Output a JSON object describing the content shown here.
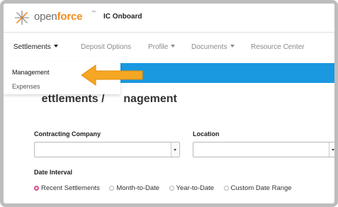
{
  "header": {
    "logo_open": "open",
    "logo_force": "force",
    "logo_tm": "™",
    "app_title": "IC Onboard"
  },
  "nav": {
    "items": [
      {
        "label": "Settlements",
        "has_caret": true,
        "active": true
      },
      {
        "label": "Deposit Options",
        "has_caret": false,
        "active": false
      },
      {
        "label": "Profile",
        "has_caret": true,
        "active": false
      },
      {
        "label": "Documents",
        "has_caret": true,
        "active": false
      },
      {
        "label": "Resource Center",
        "has_caret": false,
        "active": false
      }
    ],
    "dropdown": [
      {
        "label": "Management",
        "selected": true
      },
      {
        "label": "Expenses",
        "selected": false
      }
    ]
  },
  "page": {
    "title_visible": "ettlements / ",
    "title_end": "nagement"
  },
  "form": {
    "contracting_company_label": "Contracting Company",
    "contracting_company_value": "",
    "location_label": "Location",
    "location_value": "",
    "date_interval_label": "Date Interval",
    "date_interval_options": [
      {
        "label": "Recent Settlements",
        "selected": true
      },
      {
        "label": "Month-to-Date",
        "selected": false
      },
      {
        "label": "Year-to-Date",
        "selected": false
      },
      {
        "label": "Custom Date Range",
        "selected": false
      }
    ]
  },
  "colors": {
    "accent_blue": "#1a98e0",
    "brand_orange": "#f28c1c",
    "radio_selected": "#d34a8a",
    "arrow": "#f5a623"
  },
  "icons": {
    "logo": "openforce-star-icon",
    "pointer": "orange-arrow-icon"
  }
}
